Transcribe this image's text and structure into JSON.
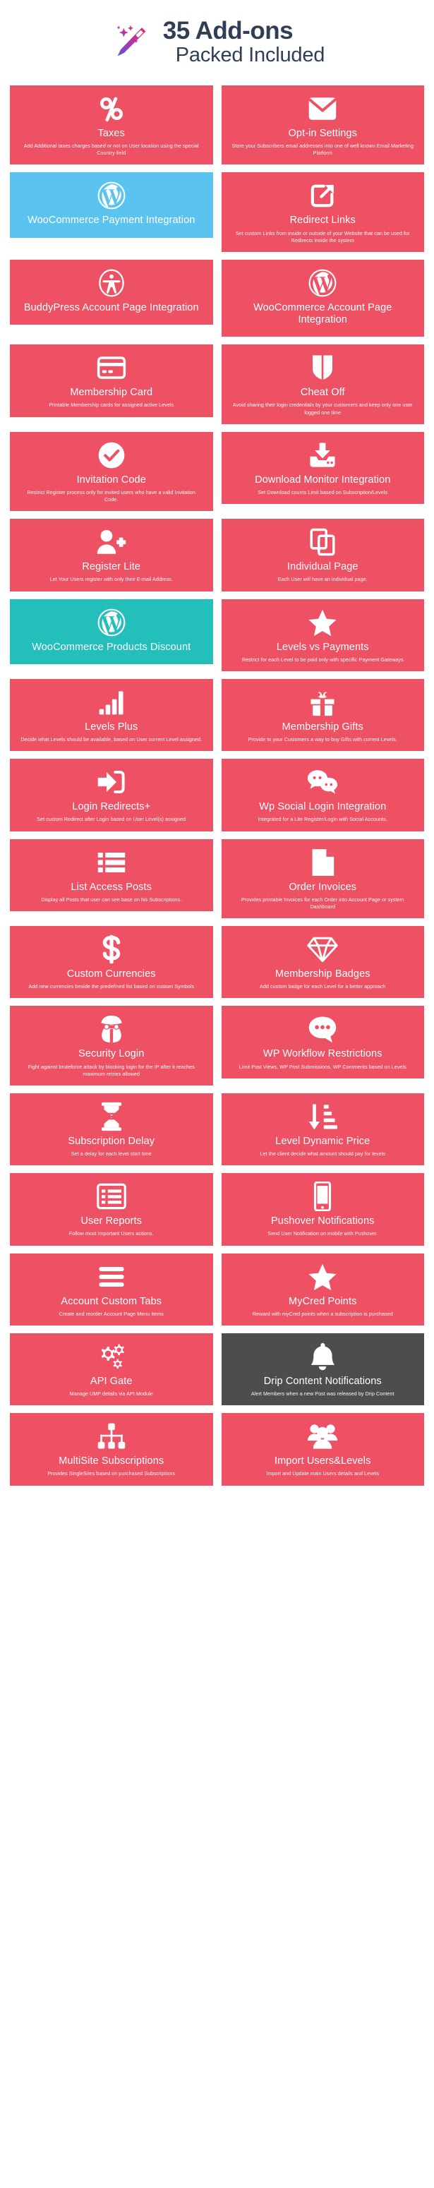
{
  "header": {
    "icon": "magic-wand-icon",
    "line1": "35 Add-ons",
    "line2": "Packed Included",
    "title_color": "#2f3e55",
    "gradient_from": "#f0246a",
    "gradient_to": "#6c4fd8"
  },
  "colors": {
    "card_default": "#ef5164",
    "card_blue": "#5bc3ef",
    "card_teal": "#22bfbb",
    "card_dark": "#4d4d4d",
    "card_text": "#ffffff",
    "page_background": "#ffffff"
  },
  "cards": [
    {
      "icon": "percent-icon",
      "title": "Taxes",
      "desc": "Add Additional taxes charges based or not on User location using the special Country field",
      "color": "default"
    },
    {
      "icon": "envelope-icon",
      "title": "Opt-in Settings",
      "desc": "Store your Subscribers email addresses into one of well known Email Marketing Platform",
      "color": "default"
    },
    {
      "icon": "wordpress-icon",
      "title": "WooCommerce Payment Integration",
      "desc": "",
      "color": "blue"
    },
    {
      "icon": "external-link-icon",
      "title": "Redirect Links",
      "desc": "Set custom Links from inside or outside of your Website that can be used for Redirects inside the system",
      "color": "default"
    },
    {
      "icon": "accessibility-person-icon",
      "title": "BuddyPress Account Page Integration",
      "desc": "",
      "color": "default"
    },
    {
      "icon": "wordpress-icon",
      "title": "WooCommerce Account Page Integration",
      "desc": "",
      "color": "default"
    },
    {
      "icon": "credit-card-icon",
      "title": "Membership Card",
      "desc": "Printable Membership cards for assigned active Levels",
      "color": "default"
    },
    {
      "icon": "shield-icon",
      "title": "Cheat Off",
      "desc": "Avoid sharing their login credentials by your customers and keep only one user logged one time",
      "color": "default"
    },
    {
      "icon": "check-circle-icon",
      "title": "Invitation Code",
      "desc": "Restrict Register process only for invited users who have a valid Invitation Code.",
      "color": "default"
    },
    {
      "icon": "download-inbox-icon",
      "title": "Download Monitor Integration",
      "desc": "Set Download counts Limit based on Subscription/Levels",
      "color": "default"
    },
    {
      "icon": "user-plus-icon",
      "title": "Register Lite",
      "desc": "Let Your Users register with only their E-mail Address.",
      "color": "default"
    },
    {
      "icon": "copy-pages-icon",
      "title": "Individual Page",
      "desc": "Each User will have an individual page.",
      "color": "default"
    },
    {
      "icon": "wordpress-icon",
      "title": "WooCommerce Products Discount",
      "desc": "",
      "color": "teal"
    },
    {
      "icon": "star-icon",
      "title": "Levels vs Payments",
      "desc": "Restrict for each Level to be paid only with specific Payment Gateways",
      "color": "default"
    },
    {
      "icon": "bar-chart-icon",
      "title": "Levels Plus",
      "desc": "Decide what Levels should be available, based on User current Level assigned.",
      "color": "default"
    },
    {
      "icon": "gift-icon",
      "title": "Membership Gifts",
      "desc": "Provide to your Customers a way to buy Gifts with current Levels.",
      "color": "default"
    },
    {
      "icon": "sign-in-icon",
      "title": "Login Redirects+",
      "desc": "Set custom Redirect after Login based on User Level(s) assigned",
      "color": "default"
    },
    {
      "icon": "chat-bubbles-icon",
      "title": "Wp Social Login Integration",
      "desc": "Integrated for a Lite Register/Login with Social Accounts.",
      "color": "default"
    },
    {
      "icon": "list-icon",
      "title": "List Access Posts",
      "desc": "Display all Posts that user can see base on his Subscriptions.",
      "color": "default"
    },
    {
      "icon": "document-icon",
      "title": "Order Invoices",
      "desc": "Provides printable Invoices for each Order into Account Page or system Dashboard",
      "color": "default"
    },
    {
      "icon": "dollar-icon",
      "title": "Custom Currencies",
      "desc": "Add new currencies beside the predefined list based on custom Symbols",
      "color": "default"
    },
    {
      "icon": "diamond-icon",
      "title": "Membership Badges",
      "desc": "Add custom badge for each Level for a better approach",
      "color": "default"
    },
    {
      "icon": "spy-icon",
      "title": "Security Login",
      "desc": "Fight against bruteforce attack by blocking login for the IP after it reaches maximum retries allowed",
      "color": "default"
    },
    {
      "icon": "comment-dots-icon",
      "title": "WP Workflow Restrictions",
      "desc": "Limit Post Views, WP Post Submissions, WP Comments based on Levels",
      "color": "default"
    },
    {
      "icon": "hourglass-icon",
      "title": "Subscription Delay",
      "desc": "Set a delay for each level start time",
      "color": "default"
    },
    {
      "icon": "sort-amount-down-icon",
      "title": "Level Dynamic Price",
      "desc": "Let the client decide what amount should pay for levels",
      "color": "default"
    },
    {
      "icon": "report-list-icon",
      "title": "User Reports",
      "desc": "Follow most important Users actions.",
      "color": "default"
    },
    {
      "icon": "mobile-phone-icon",
      "title": "Pushover Notifications",
      "desc": "Send User Notification on mobile with Pushover.",
      "color": "default"
    },
    {
      "icon": "menu-bars-icon",
      "title": "Account Custom Tabs",
      "desc": "Create and reorder Account Page Menu items",
      "color": "default"
    },
    {
      "icon": "star-icon",
      "title": "MyCred Points",
      "desc": "Reward with myCred points when a subscription is purchased",
      "color": "default"
    },
    {
      "icon": "gears-icon",
      "title": "API Gate",
      "desc": "Manage UMP details via API Module",
      "color": "default"
    },
    {
      "icon": "bell-icon",
      "title": "Drip Content Notifications",
      "desc": "Alert Members when a new Post was released by Drip Content",
      "color": "dark"
    },
    {
      "icon": "sitemap-icon",
      "title": "MultiSite Subscriptions",
      "desc": "Provides SingleSites based on purchased Subscriptions",
      "color": "default"
    },
    {
      "icon": "users-group-icon",
      "title": "Import Users&Levels",
      "desc": "Import and Update main Users details and Levels",
      "color": "default"
    }
  ]
}
